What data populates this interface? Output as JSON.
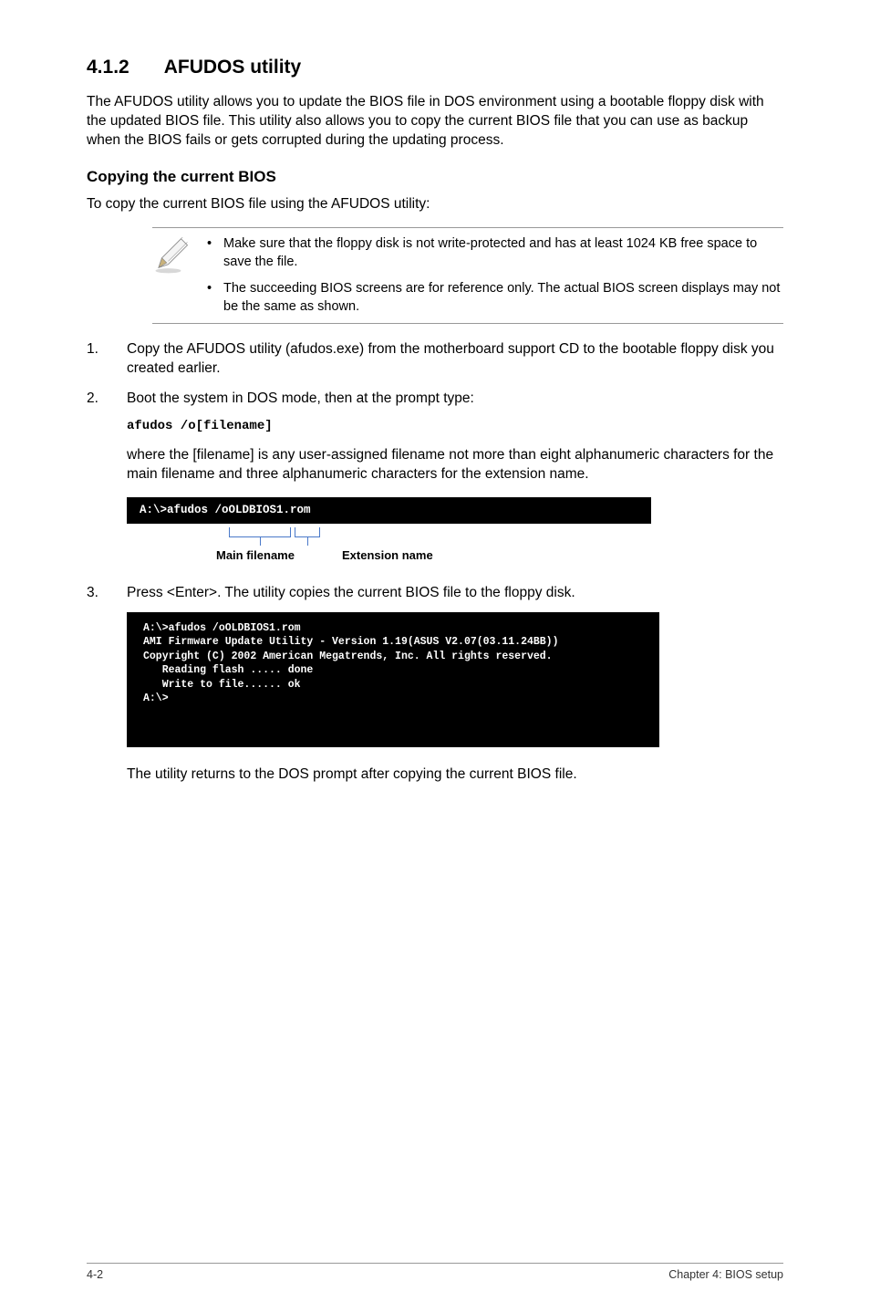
{
  "heading": {
    "number": "4.1.2",
    "title": "AFUDOS utility"
  },
  "intro": "The AFUDOS utility allows you to update the BIOS file in DOS environment using a bootable floppy disk with the updated BIOS file. This utility also allows you to copy the current BIOS file that you can use as backup when the BIOS fails or gets corrupted during the updating process.",
  "subheading": "Copying the current BIOS",
  "subintro": "To copy the current BIOS file using the AFUDOS utility:",
  "notes": [
    "Make sure that the floppy disk is not write-protected and has at least 1024 KB free space to save the file.",
    "The succeeding BIOS screens are for reference only. The actual BIOS screen displays may not be the same as shown."
  ],
  "step1": "Copy the AFUDOS utility (afudos.exe) from the motherboard support CD to the bootable floppy disk you created earlier.",
  "step2": "Boot the system in DOS mode, then at the prompt type:",
  "cmd": "afudos /o[filename]",
  "cmd_desc": "where the [filename] is any user-assigned filename not more than eight alphanumeric characters  for the main filename and three alphanumeric characters for the extension name.",
  "term1_line": "A:\\>afudos /oOLDBIOS1.rom",
  "label_main": "Main filename",
  "label_ext": "Extension name",
  "step3": "Press <Enter>. The utility copies the current BIOS file to the floppy disk.",
  "term2_lines": "A:\\>afudos /oOLDBIOS1.rom\nAMI Firmware Update Utility - Version 1.19(ASUS V2.07(03.11.24BB))\nCopyright (C) 2002 American Megatrends, Inc. All rights reserved.\n   Reading flash ..... done\n   Write to file...... ok\nA:\\>",
  "outro": "The utility returns to the DOS prompt after copying the current BIOS file.",
  "footer_left": "4-2",
  "footer_right": "Chapter 4: BIOS setup"
}
